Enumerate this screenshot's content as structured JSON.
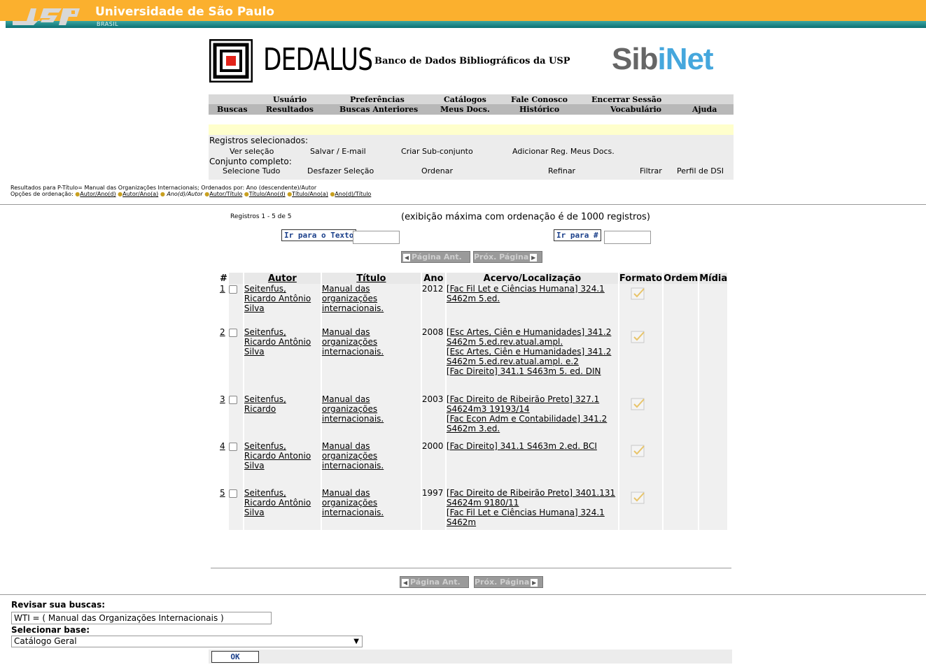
{
  "usp": {
    "name": "Universidade de São Paulo",
    "country": "BRASIL"
  },
  "dedalus": {
    "title": "DEDALUS",
    "subtitle": "Banco de Dados Bibliográficos da USP",
    "sibinet_a": "Sib",
    "sibinet_b": "i",
    "sibinet_c": "Net"
  },
  "nav": {
    "row1": [
      "Usuário",
      "Preferências",
      "Catálogos",
      "Fale Conosco",
      "Encerrar Sessão"
    ],
    "row2": [
      "Buscas",
      "Resultados",
      "Buscas Anteriores",
      "Meus Docs.",
      "Histórico",
      "Vocabulário",
      "Ajuda"
    ]
  },
  "selection": {
    "label1": "Registros selecionados:",
    "ver": "Ver seleção",
    "salvar": "Salvar / E-mail",
    "criar": "Criar Sub-conjunto",
    "adicionar": "Adicionar Reg. Meus Docs.",
    "label2": "Conjunto completo:",
    "selecione": "Selecione Tudo",
    "desfazer": "Desfazer Seleção",
    "ordenar": "Ordenar",
    "refinar": "Refinar",
    "filtrar": "Filtrar",
    "perfil": "Perfil de DSI"
  },
  "results_info": {
    "line1": "Resultados para P-Título= Manual das Organizações Internacionais; Ordenados por: Ano (descendente)/Autor",
    "prefix": "Opções de ordenação:",
    "opts": [
      "Autor/Ano(d)",
      "Autor/Ano(a)",
      "Ano(d)/Autor",
      "Autor/Título",
      "Título/Ano(d)",
      "Título/Ano(a)",
      "Ano(d)/Título"
    ]
  },
  "paging": {
    "count": "Registros 1 - 5 de 5",
    "note": "(exibição máxima com ordenação é de 1000 registros)",
    "goto_text": "Ir para o Texto",
    "goto_num": "Ir para #",
    "prev": "Página Ant.",
    "next": "Próx. Página"
  },
  "table": {
    "headers": [
      "#",
      "",
      "Autor",
      "Título",
      "Ano",
      "Acervo/Localização",
      "Formato",
      "Ordem",
      "Mídia"
    ],
    "rows": [
      {
        "num": "1",
        "autor": "Seitenfus, Ricardo Antônio Silva",
        "titulo": "Manual das organizações internacionais.",
        "ano": "2012",
        "acervo": [
          "[Fac Fil Let e Ciências Humana] 324.1 S462m 5.ed."
        ]
      },
      {
        "num": "2",
        "autor": "Seitenfus, Ricardo Antônio Silva",
        "titulo": "Manual das organizações internacionais.",
        "ano": "2008",
        "acervo": [
          "[Esc Artes, Ciên e Humanidades] 341.2 S462m 5.ed.rev.atual.ampl.",
          "[Esc Artes, Ciên e Humanidades] 341.2 S462m 5.ed.rev.atual.ampl. e.2",
          "[Fac Direito] 341.1 S463m 5. ed. DIN"
        ]
      },
      {
        "num": "3",
        "autor": "Seitenfus, Ricardo",
        "titulo": "Manual das organizações internacionais.",
        "ano": "2003",
        "acervo": [
          "[Fac Direito de Ribeirão Preto] 327.1 S4624m3 19193/14",
          "[Fac Econ Adm e Contabilidade] 341.2 S462m 3.ed."
        ]
      },
      {
        "num": "4",
        "autor": "Seitenfus, Ricardo Antonio Silva",
        "titulo": "Manual das organizações internacionais.",
        "ano": "2000",
        "acervo": [
          "[Fac Direito] 341.1 S463m 2.ed. BCI"
        ]
      },
      {
        "num": "5",
        "autor": "Seitenfus, Ricardo Antônio Silva",
        "titulo": "Manual das organizações internacionais.",
        "ano": "1997",
        "acervo": [
          "[Fac Direito de Ribeirão Preto] 3401.131 S4624m 9180/11",
          "[Fac Fil Let e Ciências Humana] 324.1 S462m"
        ]
      }
    ]
  },
  "form": {
    "revisar_label": "Revisar sua buscas:",
    "query_value": "WTI = ( Manual das Organizações Internacionais )",
    "base_label": "Selecionar base:",
    "base_value": "Catálogo Geral",
    "ok": "OK"
  },
  "colors": {
    "orange": "#fbb02e",
    "teal": "#0c6f74",
    "sibinet_blue": "#45a7dd"
  }
}
